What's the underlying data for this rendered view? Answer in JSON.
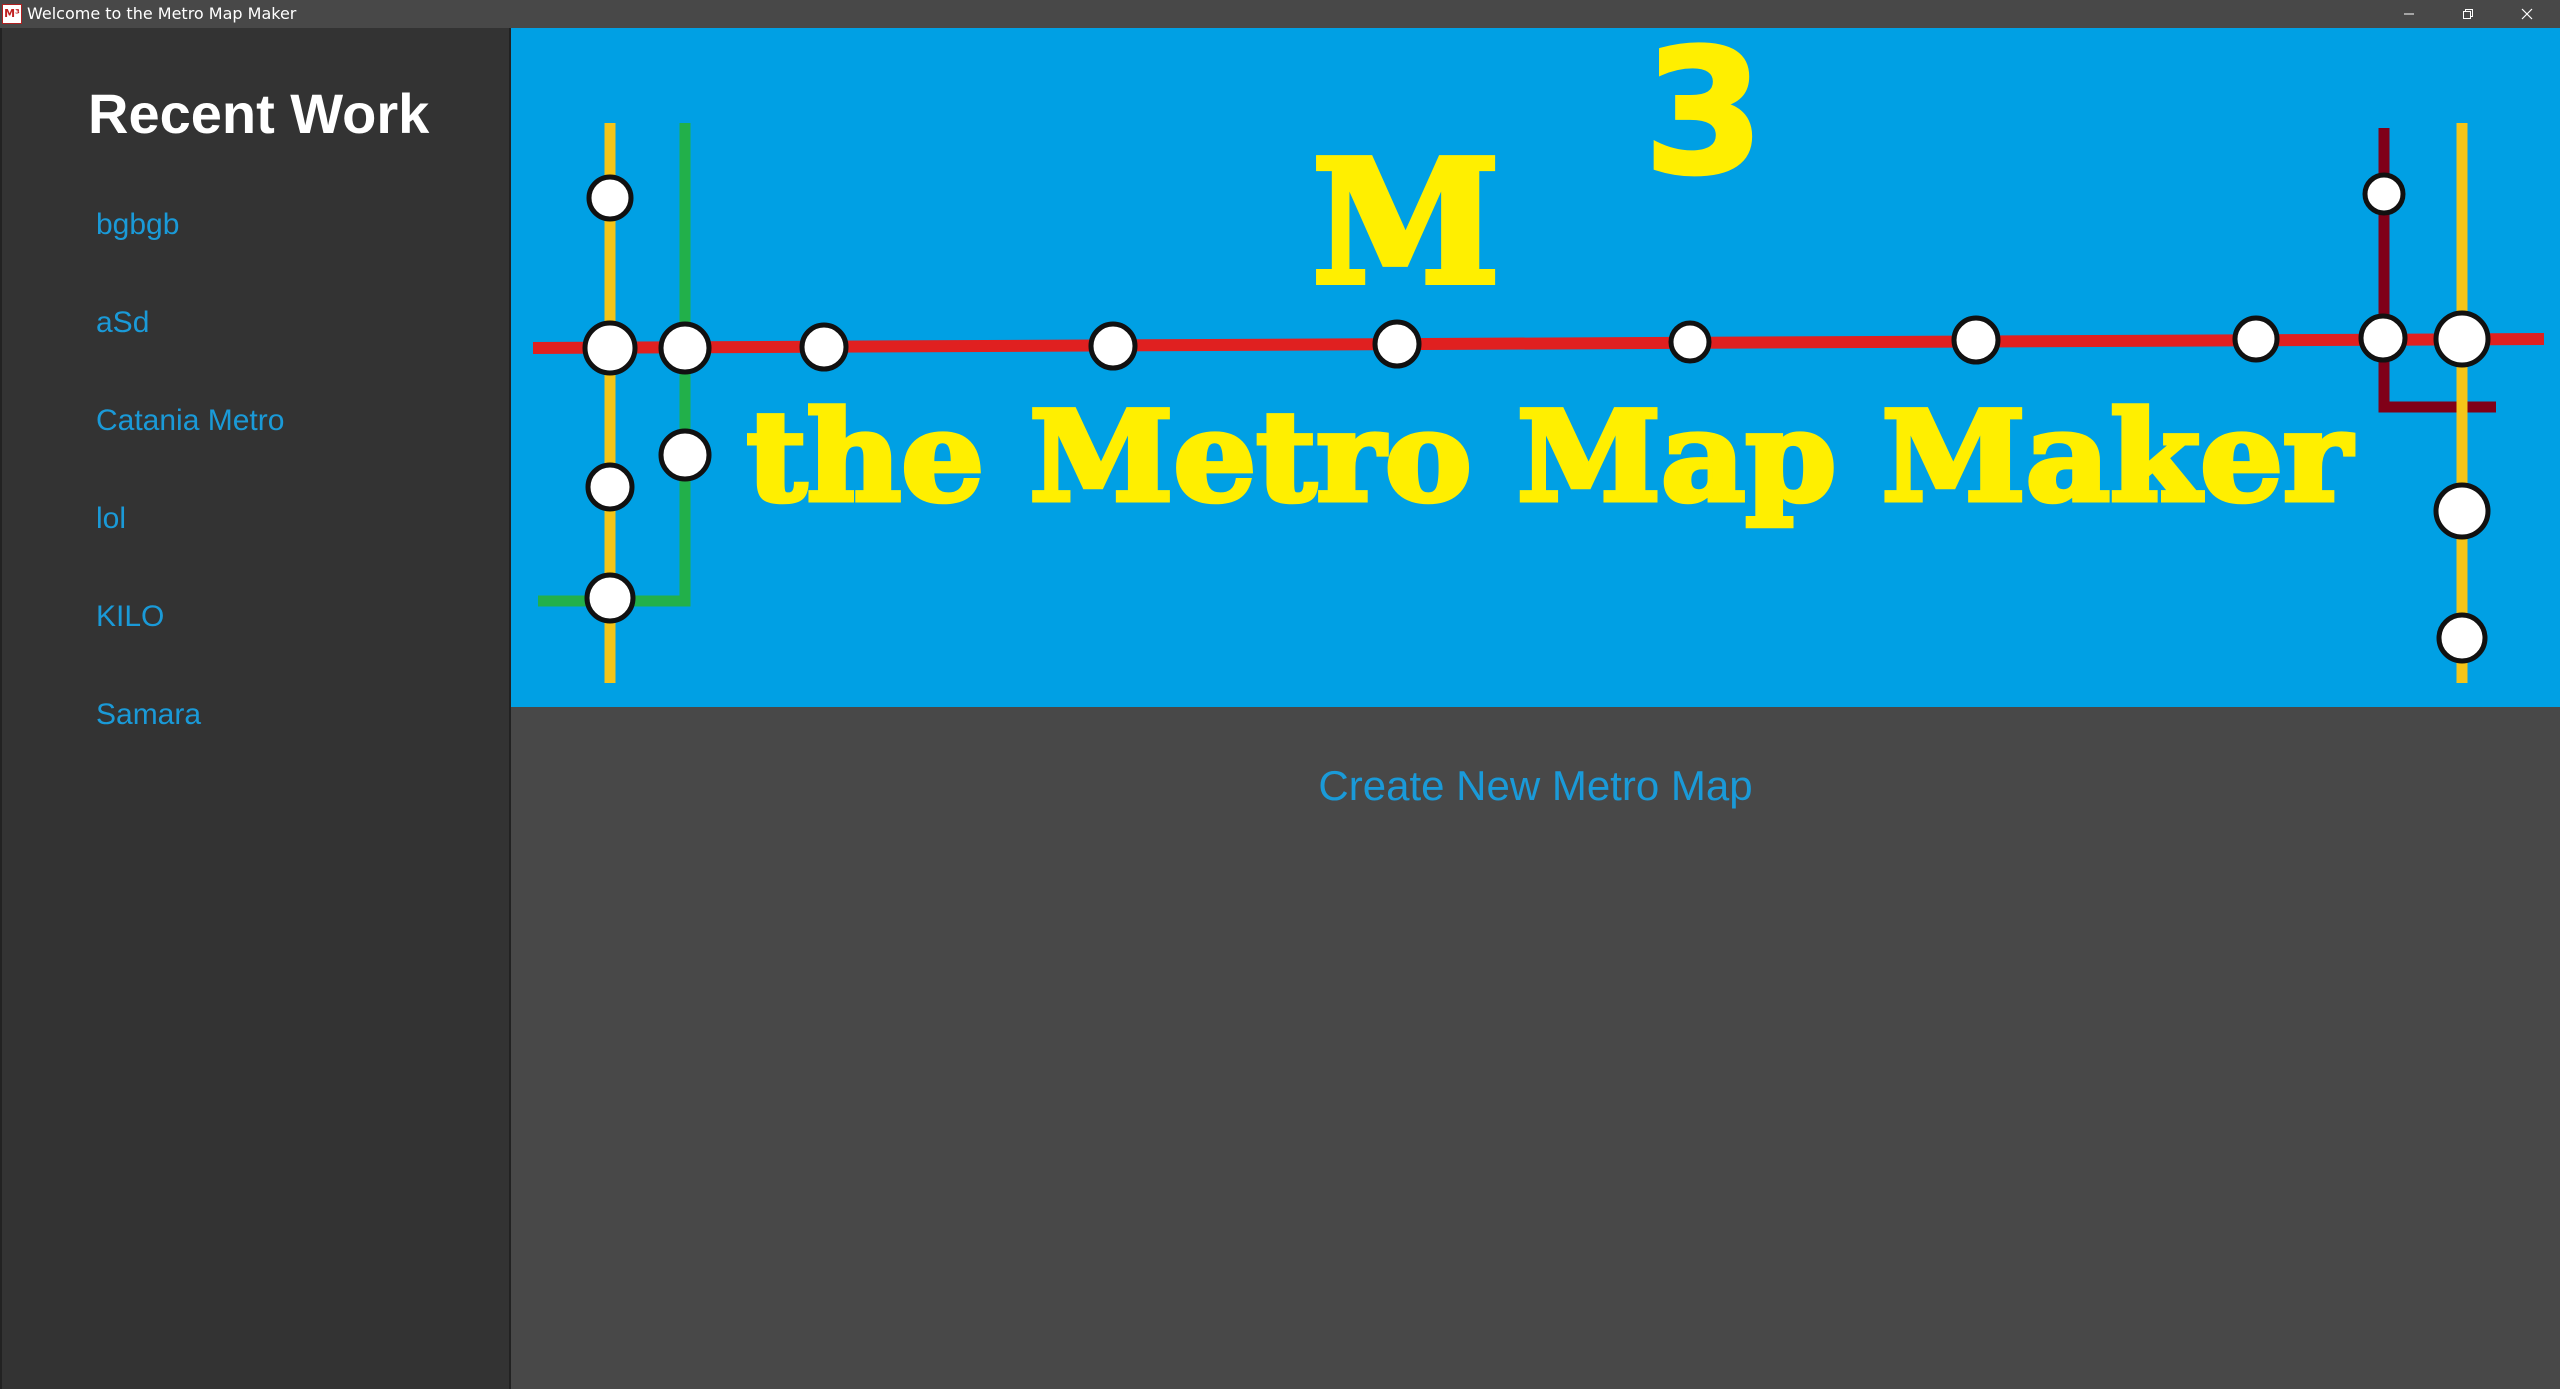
{
  "window": {
    "title": "Welcome to the Metro Map Maker",
    "icon": "app-logo-icon"
  },
  "sidebar": {
    "heading": "Recent Work",
    "items": [
      {
        "label": "bgbgb"
      },
      {
        "label": "aSd"
      },
      {
        "label": "Catania Metro"
      },
      {
        "label": "lol"
      },
      {
        "label": "KILO"
      },
      {
        "label": "Samara"
      }
    ]
  },
  "banner": {
    "logo_letter": "M",
    "logo_superscript": "3",
    "tagline": "the Metro Map Maker"
  },
  "main": {
    "create_label": "Create New Metro Map"
  },
  "colors": {
    "background": "#484848",
    "sidebar": "#333333",
    "banner_blue": "#00a0e4",
    "logo_yellow": "#ffef00",
    "link_blue": "#1a9ad8",
    "red_line": "#e02020",
    "yellow_line": "#f5c518",
    "green_line": "#22b04a",
    "maroon_line": "#800018"
  }
}
